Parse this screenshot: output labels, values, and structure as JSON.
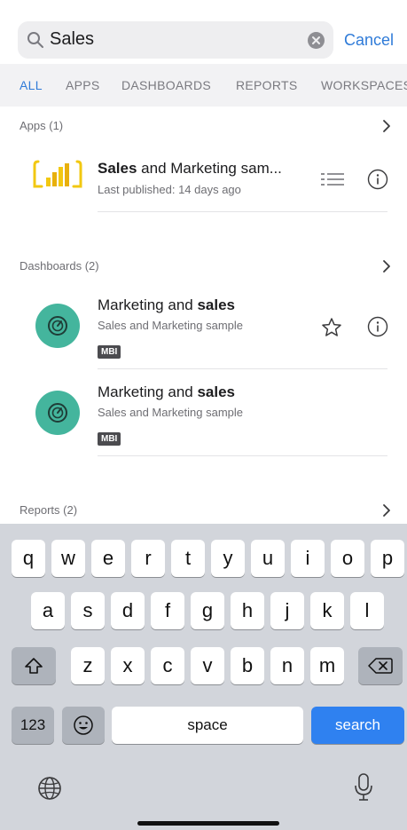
{
  "search": {
    "query": "Sales",
    "cancel_label": "Cancel"
  },
  "tabs": [
    {
      "label": "ALL",
      "active": true
    },
    {
      "label": "APPS",
      "active": false
    },
    {
      "label": "DASHBOARDS",
      "active": false
    },
    {
      "label": "REPORTS",
      "active": false
    },
    {
      "label": "WORKSPACES",
      "active": false
    }
  ],
  "apps": {
    "header": "Apps (1)",
    "items": [
      {
        "name_bold": "Sales",
        "name_rest": " and Marketing sam...",
        "subtitle": "Last published: 14 days ago"
      }
    ]
  },
  "dashboards": {
    "header": "Dashboards (2)",
    "items": [
      {
        "name_regular": "Marketing and ",
        "name_bold": "sales",
        "subtitle": "Sales and Marketing sample",
        "tag": "MBI"
      },
      {
        "name_regular": "Marketing and ",
        "name_bold": "sales",
        "subtitle": "Sales and Marketing sample",
        "tag": "MBI"
      }
    ]
  },
  "reports": {
    "header": "Reports (2)"
  },
  "keyboard": {
    "row1": [
      "q",
      "w",
      "e",
      "r",
      "t",
      "y",
      "u",
      "i",
      "o",
      "p"
    ],
    "row2": [
      "a",
      "s",
      "d",
      "f",
      "g",
      "h",
      "j",
      "k",
      "l"
    ],
    "row3": [
      "z",
      "x",
      "c",
      "v",
      "b",
      "n",
      "m"
    ],
    "numbers_label": "123",
    "space_label": "space",
    "search_label": "search"
  },
  "colors": {
    "accent": "#2f7bd8",
    "dashboard_icon": "#44b59d",
    "app_icon": "#f2c811",
    "search_key": "#2f81f0"
  }
}
